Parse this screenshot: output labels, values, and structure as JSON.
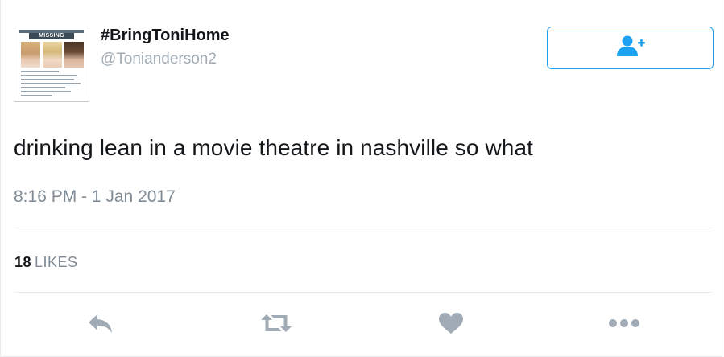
{
  "user": {
    "display_name": "#BringToniHome",
    "handle": "@Tonianderson2",
    "avatar_poster_title": "MISSING"
  },
  "follow_button": {
    "icon": "add-user-icon"
  },
  "tweet": {
    "text": "drinking lean in a movie theatre in nashville so what",
    "timestamp": "8:16 PM - 1 Jan 2017"
  },
  "stats": {
    "likes_count": "18",
    "likes_label": "LIKES"
  },
  "actions": [
    {
      "name": "reply",
      "icon": "reply-icon"
    },
    {
      "name": "retweet",
      "icon": "retweet-icon"
    },
    {
      "name": "like",
      "icon": "heart-icon"
    },
    {
      "name": "more",
      "icon": "more-dots-icon"
    }
  ],
  "colors": {
    "accent": "#1da1f2",
    "text": "#14171a",
    "muted": "#808b95",
    "icon_gray": "#a0abb5",
    "border": "#e6ecf0"
  }
}
